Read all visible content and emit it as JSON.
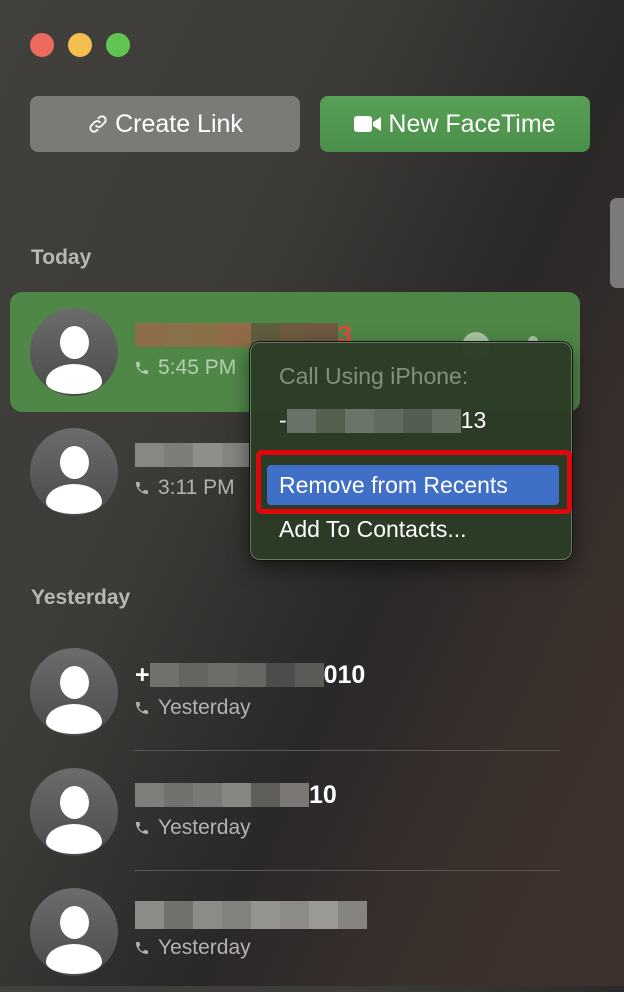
{
  "window": {
    "controls": [
      "close",
      "minimize",
      "maximize"
    ]
  },
  "toolbar": {
    "create_link": {
      "label": "Create Link",
      "icon": "link-icon"
    },
    "new_facetime": {
      "label": "New FaceTime",
      "icon": "video-camera-icon"
    }
  },
  "sections": [
    {
      "label": "Today",
      "items": [
        {
          "name_suffix": "3",
          "name_redacted": true,
          "missed": true,
          "call_type_icon": "phone-icon",
          "time": "5:45 PM",
          "selected": true
        },
        {
          "name_suffix": "",
          "name_redacted": true,
          "missed": false,
          "call_type_icon": "phone-icon",
          "time": "3:11 PM",
          "selected": false
        }
      ]
    },
    {
      "label": "Yesterday",
      "items": [
        {
          "name_prefix": "+",
          "name_suffix": "010",
          "name_redacted": true,
          "call_type_icon": "phone-icon",
          "time": "Yesterday"
        },
        {
          "name_prefix": "",
          "name_suffix": "10",
          "name_redacted": true,
          "call_type_icon": "phone-icon",
          "time": "Yesterday"
        },
        {
          "name_prefix": "",
          "name_suffix": "",
          "name_redacted": true,
          "call_type_icon": "phone-icon",
          "time": "Yesterday"
        }
      ]
    }
  ],
  "context_menu": {
    "header": "Call Using iPhone:",
    "number_prefix": "-",
    "number_suffix": "13",
    "items": [
      {
        "label": "Remove from Recents",
        "highlighted": true
      },
      {
        "label": "Add To Contacts..."
      }
    ]
  },
  "colors": {
    "accent_green": "#4f8747",
    "menu_highlight": "#3f6fc6",
    "annotation_red": "#e0070c",
    "missed_red": "#e0473d"
  }
}
